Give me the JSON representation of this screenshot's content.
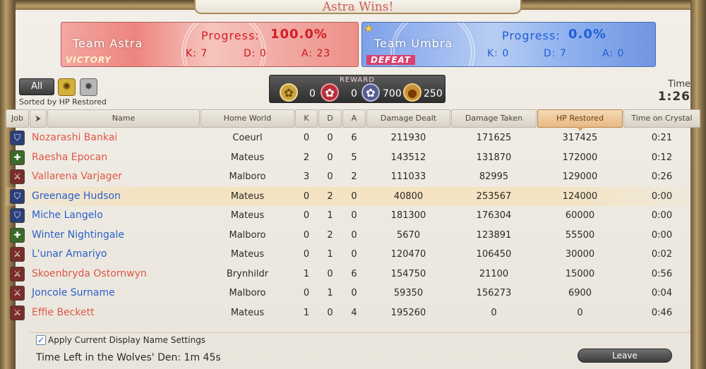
{
  "title": "Astra Wins!",
  "teams": {
    "astra": {
      "name": "Team Astra",
      "result": "VICTORY",
      "progress_label": "Progress:",
      "progress": "100.0%",
      "k": "K: 7",
      "d": "D: 0",
      "a": "A: 23"
    },
    "umbra": {
      "name": "Team Umbra",
      "result": "DEFEAT",
      "progress_label": "Progress:",
      "progress": "0.0%",
      "k": "K: 0",
      "d": "D: 7",
      "a": "A: 0"
    }
  },
  "filters": {
    "all": "All",
    "sorted_by": "Sorted by HP Restored"
  },
  "reward": {
    "label": "REWARD",
    "values": [
      "0",
      "0",
      "700",
      "250"
    ]
  },
  "time": {
    "label": "Time",
    "value": "1:26"
  },
  "columns": {
    "job": "Job",
    "name": "Name",
    "world": "Home World",
    "k": "K",
    "d": "D",
    "a": "A",
    "dealt": "Damage Dealt",
    "taken": "Damage Taken",
    "hp": "HP Restored",
    "crystal": "Time on Crystal"
  },
  "players": [
    {
      "job": "tank",
      "job_icon": "paladin-icon",
      "name": "Nozarashi Bankai",
      "team": "astra",
      "world": "Coeurl",
      "k": "0",
      "d": "0",
      "a": "6",
      "dealt": "211930",
      "taken": "171625",
      "hp": "317425",
      "crystal": "0:21"
    },
    {
      "job": "heal",
      "job_icon": "scholar-icon",
      "name": "Raesha Epocan",
      "team": "astra",
      "world": "Mateus",
      "k": "2",
      "d": "0",
      "a": "5",
      "dealt": "143512",
      "taken": "131870",
      "hp": "172000",
      "crystal": "0:12"
    },
    {
      "job": "dps",
      "job_icon": "dragoon-icon",
      "name": "Vallarena Varjager",
      "team": "astra",
      "world": "Malboro",
      "k": "3",
      "d": "0",
      "a": "2",
      "dealt": "111033",
      "taken": "82995",
      "hp": "129000",
      "crystal": "0:26"
    },
    {
      "job": "tank",
      "job_icon": "warrior-icon",
      "name": "Greenage Hudson",
      "team": "umbra",
      "world": "Mateus",
      "k": "0",
      "d": "2",
      "a": "0",
      "dealt": "40800",
      "taken": "253567",
      "hp": "124000",
      "crystal": "0:00"
    },
    {
      "job": "tank",
      "job_icon": "paladin-icon",
      "name": "Miche Langelo",
      "team": "umbra",
      "world": "Mateus",
      "k": "0",
      "d": "1",
      "a": "0",
      "dealt": "181300",
      "taken": "176304",
      "hp": "60000",
      "crystal": "0:00"
    },
    {
      "job": "heal",
      "job_icon": "whitemage-icon",
      "name": "Winter Nightingale",
      "team": "umbra",
      "world": "Malboro",
      "k": "0",
      "d": "2",
      "a": "0",
      "dealt": "5670",
      "taken": "123891",
      "hp": "55500",
      "crystal": "0:00"
    },
    {
      "job": "dps",
      "job_icon": "bard-icon",
      "name": "L'unar Amariyo",
      "team": "umbra",
      "world": "Mateus",
      "k": "0",
      "d": "1",
      "a": "0",
      "dealt": "120470",
      "taken": "106450",
      "hp": "30000",
      "crystal": "0:02"
    },
    {
      "job": "dps",
      "job_icon": "bard-icon",
      "name": "Skoenbryda Ostornwyn",
      "team": "astra",
      "world": "Brynhildr",
      "k": "1",
      "d": "0",
      "a": "6",
      "dealt": "154750",
      "taken": "21100",
      "hp": "15000",
      "crystal": "0:56"
    },
    {
      "job": "dps",
      "job_icon": "summoner-icon",
      "name": "Joncole Surname",
      "team": "umbra",
      "world": "Malboro",
      "k": "0",
      "d": "1",
      "a": "0",
      "dealt": "59350",
      "taken": "156273",
      "hp": "6900",
      "crystal": "0:04"
    },
    {
      "job": "dps",
      "job_icon": "machinist-icon",
      "name": "Effie Beckett",
      "team": "astra",
      "world": "Mateus",
      "k": "1",
      "d": "0",
      "a": "4",
      "dealt": "195260",
      "taken": "0",
      "hp": "0",
      "crystal": "0:46"
    }
  ],
  "highlight_row": 3,
  "footer": {
    "checkbox_label": "Apply Current Display Name Settings",
    "time_left": "Time Left in the Wolves' Den: 1m 45s",
    "leave": "Leave"
  }
}
